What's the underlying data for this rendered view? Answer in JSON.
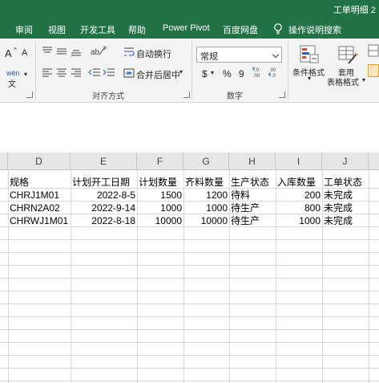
{
  "window": {
    "title": "工单明细 2"
  },
  "ribbon_tabs": [
    "审阅",
    "视图",
    "开发工具",
    "帮助",
    "Power Pivot",
    "百度网盘",
    "操作说明搜索"
  ],
  "ribbon": {
    "wrap_text": "自动换行",
    "merge_center": "合并后居中",
    "number_format": "常规",
    "currency_symbol": "$",
    "percent_symbol": "%",
    "comma_symbol": "9",
    "conditional_format": "条件格式",
    "table_format_line1": "套用",
    "table_format_line2": "表格格式",
    "alignment_group": "对齐方式",
    "number_group": "数字",
    "font_size_up": "A",
    "font_size_down": "A",
    "phonetic": "wén"
  },
  "columns": [
    "D",
    "E",
    "F",
    "G",
    "H",
    "I",
    "J"
  ],
  "table": {
    "headers": [
      "规格",
      "计划开工日期",
      "计划数量",
      "齐料数量",
      "生产状态",
      "入库数量",
      "工单状态"
    ],
    "rows": [
      [
        "CHRJ1M01",
        "2022-8-5",
        "1500",
        "1200",
        "待料",
        "200",
        "未完成"
      ],
      [
        "CHRN2A02",
        "2022-9-14",
        "1000",
        "1000",
        "待生产",
        "800",
        "未完成"
      ],
      [
        "CHRWJ1M01",
        "2022-8-18",
        "10000",
        "10000",
        "待生产",
        "1000",
        "未完成"
      ]
    ]
  },
  "colors": {
    "ribbon_green": "#217346",
    "ribbon_bg": "#f3f3f3",
    "header_bg": "#e6e6e6",
    "grid_line": "#d9d9d9"
  }
}
